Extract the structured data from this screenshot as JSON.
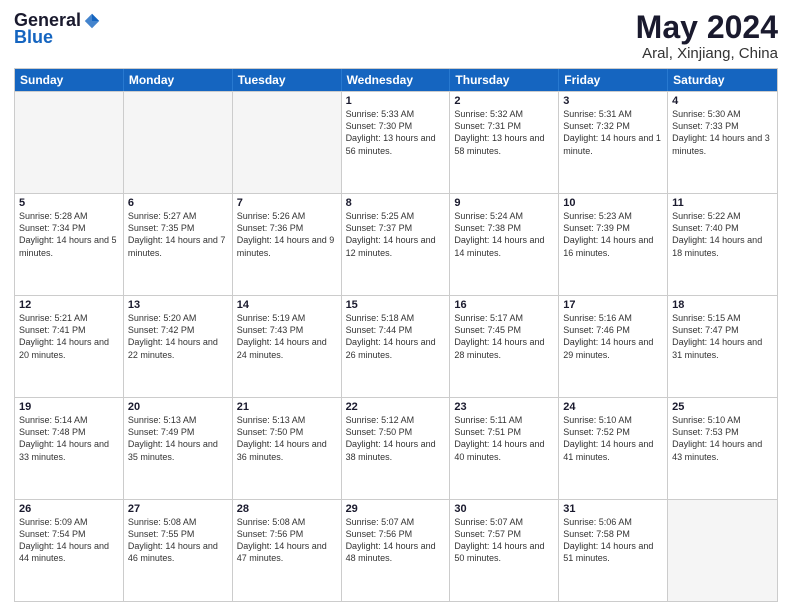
{
  "logo": {
    "general": "General",
    "blue": "Blue"
  },
  "title": "May 2024",
  "location": "Aral, Xinjiang, China",
  "days_of_week": [
    "Sunday",
    "Monday",
    "Tuesday",
    "Wednesday",
    "Thursday",
    "Friday",
    "Saturday"
  ],
  "weeks": [
    [
      {
        "day": "",
        "empty": true
      },
      {
        "day": "",
        "empty": true
      },
      {
        "day": "",
        "empty": true
      },
      {
        "day": "1",
        "sunrise": "5:33 AM",
        "sunset": "7:30 PM",
        "daylight": "13 hours and 56 minutes."
      },
      {
        "day": "2",
        "sunrise": "5:32 AM",
        "sunset": "7:31 PM",
        "daylight": "13 hours and 58 minutes."
      },
      {
        "day": "3",
        "sunrise": "5:31 AM",
        "sunset": "7:32 PM",
        "daylight": "14 hours and 1 minute."
      },
      {
        "day": "4",
        "sunrise": "5:30 AM",
        "sunset": "7:33 PM",
        "daylight": "14 hours and 3 minutes."
      }
    ],
    [
      {
        "day": "5",
        "sunrise": "5:28 AM",
        "sunset": "7:34 PM",
        "daylight": "14 hours and 5 minutes."
      },
      {
        "day": "6",
        "sunrise": "5:27 AM",
        "sunset": "7:35 PM",
        "daylight": "14 hours and 7 minutes."
      },
      {
        "day": "7",
        "sunrise": "5:26 AM",
        "sunset": "7:36 PM",
        "daylight": "14 hours and 9 minutes."
      },
      {
        "day": "8",
        "sunrise": "5:25 AM",
        "sunset": "7:37 PM",
        "daylight": "14 hours and 12 minutes."
      },
      {
        "day": "9",
        "sunrise": "5:24 AM",
        "sunset": "7:38 PM",
        "daylight": "14 hours and 14 minutes."
      },
      {
        "day": "10",
        "sunrise": "5:23 AM",
        "sunset": "7:39 PM",
        "daylight": "14 hours and 16 minutes."
      },
      {
        "day": "11",
        "sunrise": "5:22 AM",
        "sunset": "7:40 PM",
        "daylight": "14 hours and 18 minutes."
      }
    ],
    [
      {
        "day": "12",
        "sunrise": "5:21 AM",
        "sunset": "7:41 PM",
        "daylight": "14 hours and 20 minutes."
      },
      {
        "day": "13",
        "sunrise": "5:20 AM",
        "sunset": "7:42 PM",
        "daylight": "14 hours and 22 minutes."
      },
      {
        "day": "14",
        "sunrise": "5:19 AM",
        "sunset": "7:43 PM",
        "daylight": "14 hours and 24 minutes."
      },
      {
        "day": "15",
        "sunrise": "5:18 AM",
        "sunset": "7:44 PM",
        "daylight": "14 hours and 26 minutes."
      },
      {
        "day": "16",
        "sunrise": "5:17 AM",
        "sunset": "7:45 PM",
        "daylight": "14 hours and 28 minutes."
      },
      {
        "day": "17",
        "sunrise": "5:16 AM",
        "sunset": "7:46 PM",
        "daylight": "14 hours and 29 minutes."
      },
      {
        "day": "18",
        "sunrise": "5:15 AM",
        "sunset": "7:47 PM",
        "daylight": "14 hours and 31 minutes."
      }
    ],
    [
      {
        "day": "19",
        "sunrise": "5:14 AM",
        "sunset": "7:48 PM",
        "daylight": "14 hours and 33 minutes."
      },
      {
        "day": "20",
        "sunrise": "5:13 AM",
        "sunset": "7:49 PM",
        "daylight": "14 hours and 35 minutes."
      },
      {
        "day": "21",
        "sunrise": "5:13 AM",
        "sunset": "7:50 PM",
        "daylight": "14 hours and 36 minutes."
      },
      {
        "day": "22",
        "sunrise": "5:12 AM",
        "sunset": "7:50 PM",
        "daylight": "14 hours and 38 minutes."
      },
      {
        "day": "23",
        "sunrise": "5:11 AM",
        "sunset": "7:51 PM",
        "daylight": "14 hours and 40 minutes."
      },
      {
        "day": "24",
        "sunrise": "5:10 AM",
        "sunset": "7:52 PM",
        "daylight": "14 hours and 41 minutes."
      },
      {
        "day": "25",
        "sunrise": "5:10 AM",
        "sunset": "7:53 PM",
        "daylight": "14 hours and 43 minutes."
      }
    ],
    [
      {
        "day": "26",
        "sunrise": "5:09 AM",
        "sunset": "7:54 PM",
        "daylight": "14 hours and 44 minutes."
      },
      {
        "day": "27",
        "sunrise": "5:08 AM",
        "sunset": "7:55 PM",
        "daylight": "14 hours and 46 minutes."
      },
      {
        "day": "28",
        "sunrise": "5:08 AM",
        "sunset": "7:56 PM",
        "daylight": "14 hours and 47 minutes."
      },
      {
        "day": "29",
        "sunrise": "5:07 AM",
        "sunset": "7:56 PM",
        "daylight": "14 hours and 48 minutes."
      },
      {
        "day": "30",
        "sunrise": "5:07 AM",
        "sunset": "7:57 PM",
        "daylight": "14 hours and 50 minutes."
      },
      {
        "day": "31",
        "sunrise": "5:06 AM",
        "sunset": "7:58 PM",
        "daylight": "14 hours and 51 minutes."
      },
      {
        "day": "",
        "empty": true
      }
    ]
  ]
}
